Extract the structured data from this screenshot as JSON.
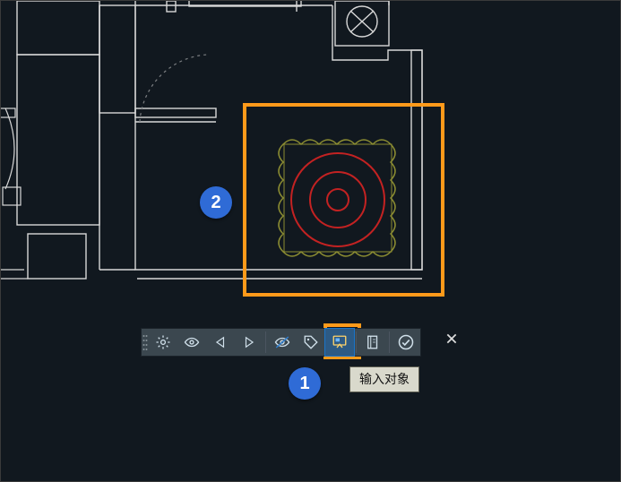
{
  "annotations": {
    "badge1": "1",
    "badge2": "2"
  },
  "tooltip": {
    "text": "输入对象"
  },
  "toolbar": {
    "buttons": [
      {
        "name": "settings",
        "icon": "gear-icon"
      },
      {
        "name": "visibility",
        "icon": "eye-icon"
      },
      {
        "name": "step-back",
        "icon": "triangle-left-icon"
      },
      {
        "name": "step-forward",
        "icon": "triangle-right-icon"
      },
      {
        "name": "toggle-visibility",
        "icon": "eye-off-icon"
      },
      {
        "name": "category",
        "icon": "tag-icon"
      },
      {
        "name": "input-object",
        "icon": "shape-in-icon",
        "active": true
      },
      {
        "name": "notes",
        "icon": "notebook-icon"
      },
      {
        "name": "accept",
        "icon": "check-circle-icon"
      }
    ]
  },
  "colors": {
    "highlight": "#ff9a1a",
    "badge": "#2f6bd6",
    "target_ring": "#c32222",
    "decor": "#8c8d32"
  }
}
